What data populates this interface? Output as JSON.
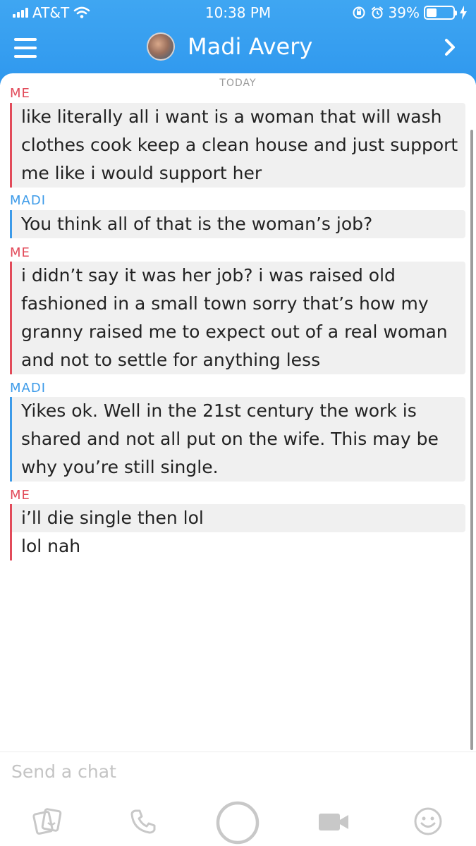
{
  "status_bar": {
    "carrier": "AT&T",
    "time": "10:38 PM",
    "battery_percent": "39%",
    "battery_level": 0.39
  },
  "header": {
    "contact_name": "Madi Avery",
    "icons": [
      "hamburger-icon",
      "avatar",
      "chevron-right-icon"
    ],
    "accent_color": "#2f98ee"
  },
  "chat": {
    "date_label": "TODAY",
    "colors": {
      "me": "#e24b5a",
      "madi": "#3d9be9"
    },
    "groups": [
      {
        "sender": "ME",
        "lines": [
          "like literally all i want is a woman that will wash",
          "clothes cook keep a clean house and just support",
          "me like i would support her"
        ]
      },
      {
        "sender": "MADI",
        "lines": [
          "You think all of that is the woman’s job?"
        ]
      },
      {
        "sender": "ME",
        "lines": [
          "i didn’t say it was her job? i was raised old",
          "fashioned in a small town sorry that’s how my",
          "granny raised me to expect out of a real woman",
          "and not to settle for anything less"
        ]
      },
      {
        "sender": "MADI",
        "lines": [
          "Yikes ok. Well in the 21st century the work is",
          "shared and not all put on the wife. This may be",
          "why you’re still single."
        ]
      },
      {
        "sender": "ME",
        "lines": [
          "i’ll die single then lol"
        ]
      },
      {
        "sender": "",
        "lines": [
          "lol nah"
        ]
      }
    ]
  },
  "composer": {
    "placeholder": "Send a chat"
  },
  "bottom_bar": {
    "icons": [
      "sticker-icon",
      "phone-icon",
      "camera-shutter-icon",
      "video-icon",
      "emoji-icon"
    ]
  }
}
